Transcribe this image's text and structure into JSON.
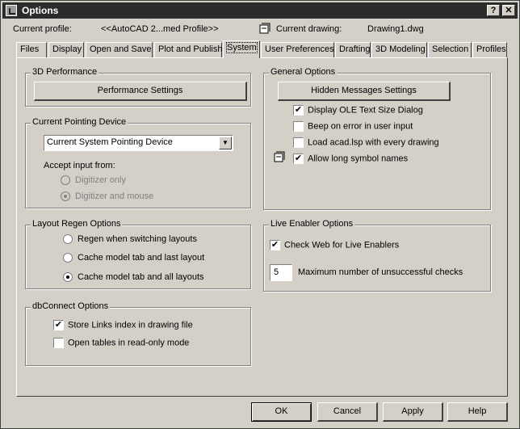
{
  "window": {
    "title": "Options",
    "controls": {
      "help": "?",
      "close": "✕"
    }
  },
  "profile": {
    "current_profile_label": "Current profile:",
    "current_profile_value": "<<AutoCAD 2...med Profile>>",
    "current_drawing_label": "Current drawing:",
    "current_drawing_value": "Drawing1.dwg"
  },
  "tabs": [
    {
      "label": "Files"
    },
    {
      "label": "Display"
    },
    {
      "label": "Open and Save"
    },
    {
      "label": "Plot and Publish"
    },
    {
      "label": "System",
      "active": true
    },
    {
      "label": "User Preferences"
    },
    {
      "label": "Drafting"
    },
    {
      "label": "3D Modeling"
    },
    {
      "label": "Selection"
    },
    {
      "label": "Profiles"
    }
  ],
  "performance": {
    "title": "3D Performance",
    "button": "Performance Settings"
  },
  "pointing": {
    "title": "Current Pointing Device",
    "select_value": "Current System Pointing Device",
    "accept_label": "Accept input from:",
    "options": [
      {
        "label": "Digitizer only",
        "selected": false
      },
      {
        "label": "Digitizer and mouse",
        "selected": true
      }
    ]
  },
  "layout_regen": {
    "title": "Layout Regen Options",
    "options": [
      {
        "label": "Regen when switching layouts",
        "selected": false
      },
      {
        "label": "Cache model tab and last layout",
        "selected": false
      },
      {
        "label": "Cache model tab and all layouts",
        "selected": true
      }
    ]
  },
  "dbconnect": {
    "title": "dbConnect Options",
    "checks": [
      {
        "label": "Store Links index in drawing file",
        "checked": true
      },
      {
        "label": "Open tables in read-only mode",
        "checked": false
      }
    ]
  },
  "general": {
    "title": "General Options",
    "button": "Hidden Messages Settings",
    "checks": [
      {
        "label": "Display OLE Text Size Dialog",
        "checked": true
      },
      {
        "label": "Beep on error in user input",
        "checked": false
      },
      {
        "label": "Load acad.lsp with every drawing",
        "checked": false
      },
      {
        "label": "Allow long symbol names",
        "checked": true
      }
    ]
  },
  "live_enabler": {
    "title": "Live Enabler Options",
    "check_label": "Check Web for Live Enablers",
    "checked": true,
    "max_checks_value": "5",
    "max_checks_label": "Maximum number of unsuccessful checks"
  },
  "footer": {
    "ok": "OK",
    "cancel": "Cancel",
    "apply": "Apply",
    "help": "Help"
  }
}
